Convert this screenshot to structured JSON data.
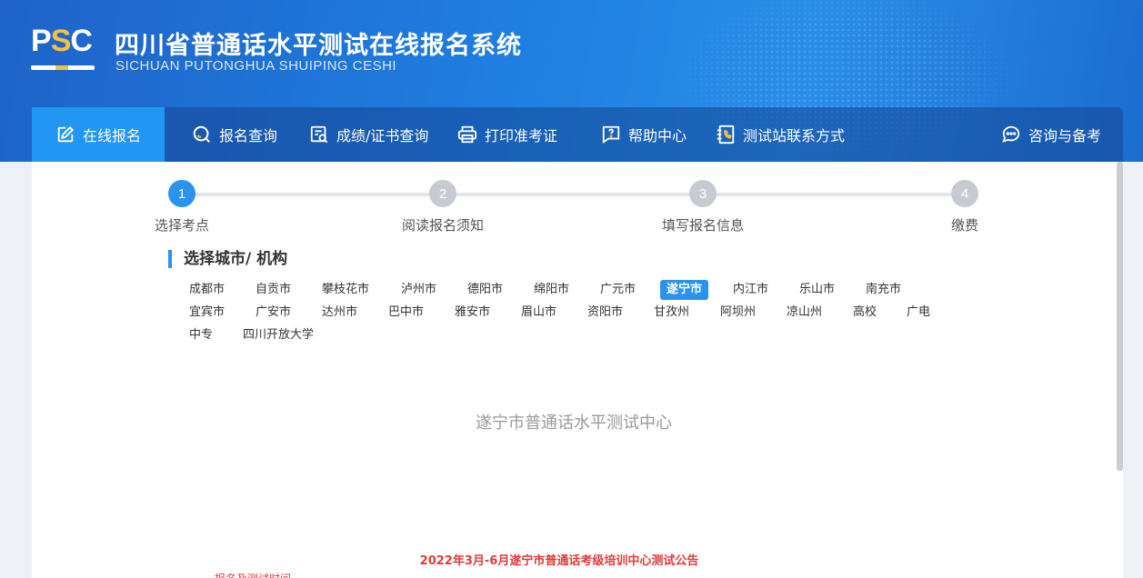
{
  "header": {
    "logo": {
      "p": "P",
      "s": "S",
      "c": "C"
    },
    "title": "四川省普通话水平测试在线报名系统",
    "subtitle": "SICHUAN PUTONGHUA SHUIPING CESHI"
  },
  "nav": {
    "items": [
      {
        "label": "在线报名",
        "icon": "edit-icon"
      },
      {
        "label": "报名查询",
        "icon": "search-icon"
      },
      {
        "label": "成绩/证书查询",
        "icon": "certificate-search-icon"
      },
      {
        "label": "打印准考证",
        "icon": "printer-icon"
      },
      {
        "label": "帮助中心",
        "icon": "help-icon"
      },
      {
        "label": "测试站联系方式",
        "icon": "phone-book-icon"
      },
      {
        "label": "咨询与备考",
        "icon": "chat-icon"
      }
    ],
    "active_index": 0
  },
  "steps": [
    {
      "num": "1",
      "label": "选择考点"
    },
    {
      "num": "2",
      "label": "阅读报名须知"
    },
    {
      "num": "3",
      "label": "填写报名信息"
    },
    {
      "num": "4",
      "label": "缴费"
    }
  ],
  "current_step": 1,
  "section_title": "选择城市/ 机构",
  "cities": [
    "成都市",
    "自贡市",
    "攀枝花市",
    "泸州市",
    "德阳市",
    "绵阳市",
    "广元市",
    "遂宁市",
    "内江市",
    "乐山市",
    "南充市",
    "宜宾市",
    "广安市",
    "达州市",
    "巴中市",
    "雅安市",
    "眉山市",
    "资阳市",
    "甘孜州",
    "阿坝州",
    "凉山州",
    "高校",
    "广电",
    "中专",
    "四川开放大学"
  ],
  "selected_city": "遂宁市",
  "center_name": "遂宁市普通话水平测试中心",
  "notice_title": "2022年3月-6月遂宁市普通话考级培训中心测试公告",
  "notice_sub": "一、报名及测试时间",
  "colors": {
    "primary": "#2a93f0",
    "header_blue": "#1f7fe0",
    "notice_red": "#e23b3b",
    "logo_yellow": "#f5c33b"
  }
}
